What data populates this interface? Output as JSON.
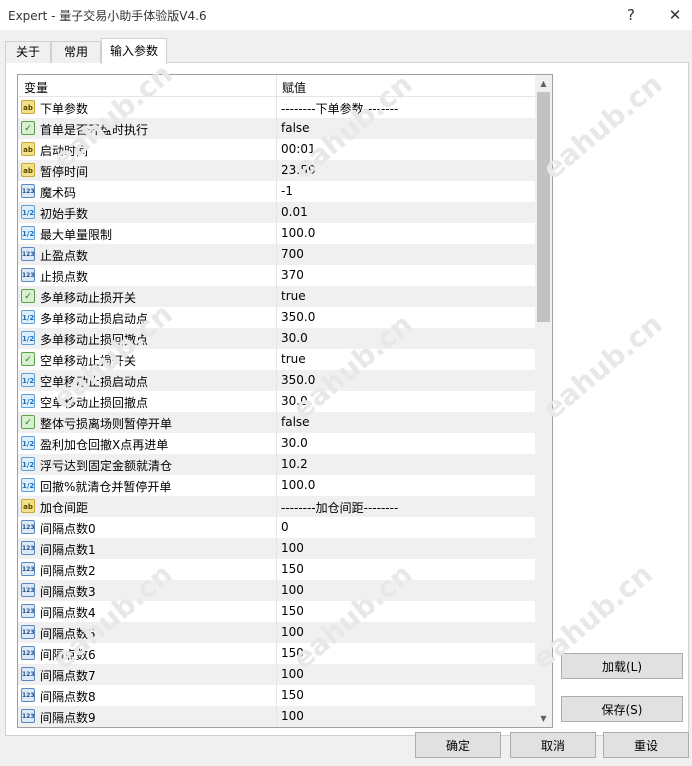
{
  "window": {
    "title": "Expert - 量子交易小助手体验版V4.6",
    "help_label": "?",
    "close_label": "✕"
  },
  "tabs": [
    {
      "label": "关于"
    },
    {
      "label": "常用"
    },
    {
      "label": "输入参数"
    }
  ],
  "table": {
    "headers": {
      "name": "变量",
      "value": "赋值"
    },
    "rows": [
      {
        "icon": "ab",
        "name": "下单参数",
        "value": "--------下单参数--------"
      },
      {
        "icon": "bool",
        "name": "首单是否开盘时执行",
        "value": "false"
      },
      {
        "icon": "ab",
        "name": "启动时间",
        "value": "00:01"
      },
      {
        "icon": "ab",
        "name": "暂停时间",
        "value": "23:59"
      },
      {
        "icon": "int",
        "name": "魔术码",
        "value": "-1"
      },
      {
        "icon": "dbl",
        "name": "初始手数",
        "value": "0.01"
      },
      {
        "icon": "dbl",
        "name": "最大单量限制",
        "value": "100.0"
      },
      {
        "icon": "int",
        "name": "止盈点数",
        "value": "700"
      },
      {
        "icon": "int",
        "name": "止损点数",
        "value": "370"
      },
      {
        "icon": "bool",
        "name": "多单移动止损开关",
        "value": "true"
      },
      {
        "icon": "dbl",
        "name": "多单移动止损启动点",
        "value": "350.0"
      },
      {
        "icon": "dbl",
        "name": "多单移动止损回撤点",
        "value": "30.0"
      },
      {
        "icon": "bool",
        "name": "空单移动止损开关",
        "value": "true"
      },
      {
        "icon": "dbl",
        "name": "空单移动止损启动点",
        "value": "350.0"
      },
      {
        "icon": "dbl",
        "name": "空单移动止损回撤点",
        "value": "30.0"
      },
      {
        "icon": "bool",
        "name": "整体亏损离场则暂停开单",
        "value": "false"
      },
      {
        "icon": "dbl",
        "name": "盈利加仓回撤X点再进单",
        "value": "30.0"
      },
      {
        "icon": "dbl",
        "name": "浮亏达到固定金额就清仓",
        "value": "10.2"
      },
      {
        "icon": "dbl",
        "name": "回撤%就清仓并暂停开单",
        "value": "100.0"
      },
      {
        "icon": "ab",
        "name": "加仓间距",
        "value": "--------加仓间距--------"
      },
      {
        "icon": "int",
        "name": "间隔点数0",
        "value": "0"
      },
      {
        "icon": "int",
        "name": "间隔点数1",
        "value": "100"
      },
      {
        "icon": "int",
        "name": "间隔点数2",
        "value": "150"
      },
      {
        "icon": "int",
        "name": "间隔点数3",
        "value": "100"
      },
      {
        "icon": "int",
        "name": "间隔点数4",
        "value": "150"
      },
      {
        "icon": "int",
        "name": "间隔点数5",
        "value": "100"
      },
      {
        "icon": "int",
        "name": "间隔点数6",
        "value": "150"
      },
      {
        "icon": "int",
        "name": "间隔点数7",
        "value": "100"
      },
      {
        "icon": "int",
        "name": "间隔点数8",
        "value": "150"
      },
      {
        "icon": "int",
        "name": "间隔点数9",
        "value": "100"
      }
    ]
  },
  "icon_glyphs": {
    "ab": "ab",
    "bool": "✓",
    "int": "123",
    "dbl": "1/2"
  },
  "buttons": {
    "load": "加载(L)",
    "save": "保存(S)",
    "ok": "确定",
    "cancel": "取消",
    "reset": "重设"
  },
  "watermark": "eahub.cn"
}
